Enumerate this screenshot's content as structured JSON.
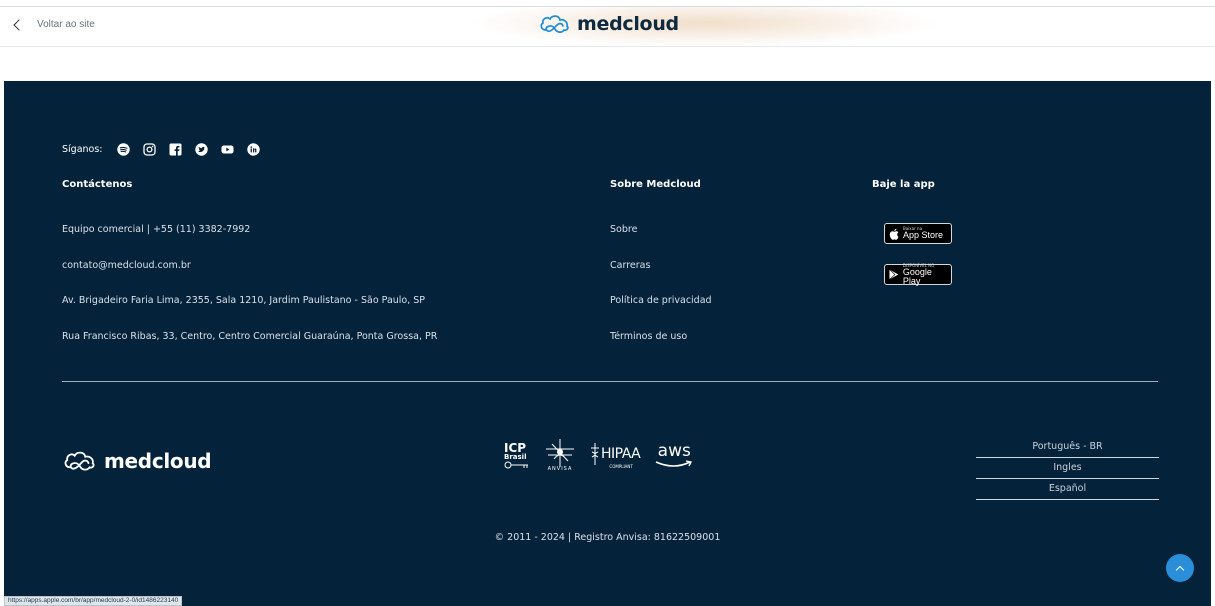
{
  "header": {
    "back_label": "Voltar ao site",
    "logo_text": "medcloud"
  },
  "footer": {
    "social": {
      "label": "Síganos:",
      "icons": [
        "spotify-icon",
        "instagram-icon",
        "facebook-icon",
        "twitter-icon",
        "youtube-icon",
        "linkedin-icon"
      ]
    },
    "contact": {
      "heading": "Contáctenos",
      "items": [
        "Equipo comercial | +55 (11) 3382-7992",
        "contato@medcloud.com.br",
        "Av. Brigadeiro Faria Lima, 2355, Sala 1210, Jardim Paulistano - São Paulo, SP",
        "Rua Francisco Ribas, 33, Centro, Centro Comercial Guaraúna, Ponta Grossa, PR"
      ]
    },
    "about": {
      "heading": "Sobre Medcloud",
      "links": [
        "Sobre",
        "Carreras",
        "Política de privacidad",
        "Términos de uso"
      ]
    },
    "app": {
      "heading": "Baje la app",
      "app_store": {
        "small": "Baixar na",
        "big": "App Store"
      },
      "google_play": {
        "small": "DISPONÍVEL NO",
        "big": "Google Play"
      }
    },
    "logo_text": "medcloud",
    "certifications": {
      "icp_top": "ICP",
      "icp_bottom": "Brasil",
      "anvisa": "ANVISA",
      "hipaa": "HIPAA",
      "hipaa_sub": "COMPLIANT",
      "aws": "aws"
    },
    "languages": [
      "Português - BR",
      "Ingles",
      "Español"
    ],
    "copyright": "© 2011 - 2024 | Registro Anvisa: 81622509001"
  },
  "status_url": "https://apps.apple.com/br/app/medcloud-2-0/id1486223140",
  "colors": {
    "footer_bg": "#04223a",
    "accent_blue": "#2a8fd8",
    "logo_dark": "#0f2a3e"
  }
}
